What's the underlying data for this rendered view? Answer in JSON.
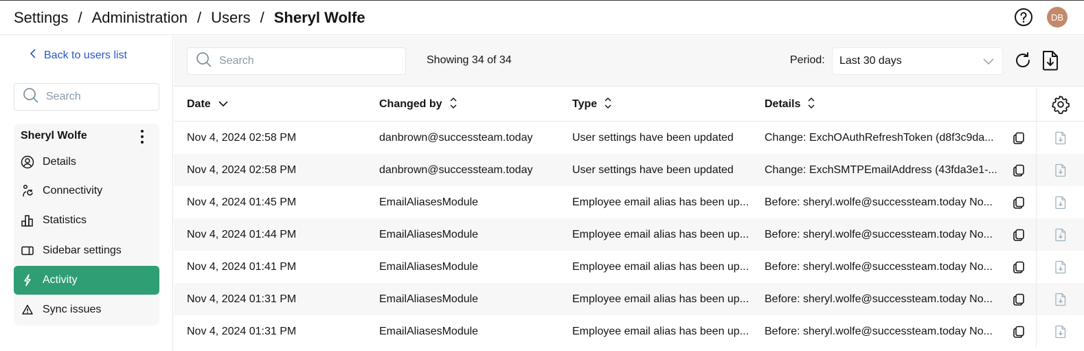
{
  "header": {
    "breadcrumb": [
      "Settings",
      "Administration",
      "Users",
      "Sheryl Wolfe"
    ],
    "separator": "/",
    "avatar_initials": "DB",
    "help_icon": "help-circle-icon"
  },
  "sidebar": {
    "back_label": "Back to users list",
    "search_placeholder": "Search",
    "user_name": "Sheryl Wolfe",
    "items": [
      {
        "label": "Details",
        "icon": "user-circle-icon",
        "active": false
      },
      {
        "label": "Connectivity",
        "icon": "connectivity-icon",
        "active": false
      },
      {
        "label": "Statistics",
        "icon": "bar-chart-icon",
        "active": false
      },
      {
        "label": "Sidebar settings",
        "icon": "sidebar-panel-icon",
        "active": false
      },
      {
        "label": "Activity",
        "icon": "lightning-icon",
        "active": true
      },
      {
        "label": "Sync issues",
        "icon": "warning-triangle-icon",
        "active": false
      }
    ]
  },
  "toolbar": {
    "search_placeholder": "Search",
    "showing": "Showing 34 of 34",
    "period_label": "Period:",
    "period_value": "Last 30 days"
  },
  "table": {
    "columns": [
      "Date",
      "Changed by",
      "Type",
      "Details"
    ],
    "rows": [
      {
        "date": "Nov 4, 2024 02:58 PM",
        "changed_by": "danbrown@successteam.today",
        "type": "User settings have been updated",
        "details": "Change: ExchOAuthRefreshToken (d8f3c9da..."
      },
      {
        "date": "Nov 4, 2024 02:58 PM",
        "changed_by": "danbrown@successteam.today",
        "type": "User settings have been updated",
        "details": "Change: ExchSMTPEmailAddress (43fda3e1-..."
      },
      {
        "date": "Nov 4, 2024 01:45 PM",
        "changed_by": "EmailAliasesModule",
        "type": "Employee email alias has been up...",
        "details": "Before: sheryl.wolfe@successteam.today No..."
      },
      {
        "date": "Nov 4, 2024 01:44 PM",
        "changed_by": "EmailAliasesModule",
        "type": "Employee email alias has been up...",
        "details": "Before: sheryl.wolfe@successteam.today No..."
      },
      {
        "date": "Nov 4, 2024 01:41 PM",
        "changed_by": "EmailAliasesModule",
        "type": "Employee email alias has been up...",
        "details": "Before: sheryl.wolfe@successteam.today No..."
      },
      {
        "date": "Nov 4, 2024 01:31 PM",
        "changed_by": "EmailAliasesModule",
        "type": "Employee email alias has been up...",
        "details": "Before: sheryl.wolfe@successteam.today No..."
      },
      {
        "date": "Nov 4, 2024 01:31 PM",
        "changed_by": "EmailAliasesModule",
        "type": "Employee email alias has been up...",
        "details": "Before: sheryl.wolfe@successteam.today No..."
      }
    ]
  },
  "colors": {
    "accent": "#2f9e75",
    "link": "#2a55c8",
    "avatar": "#c28a6a"
  }
}
